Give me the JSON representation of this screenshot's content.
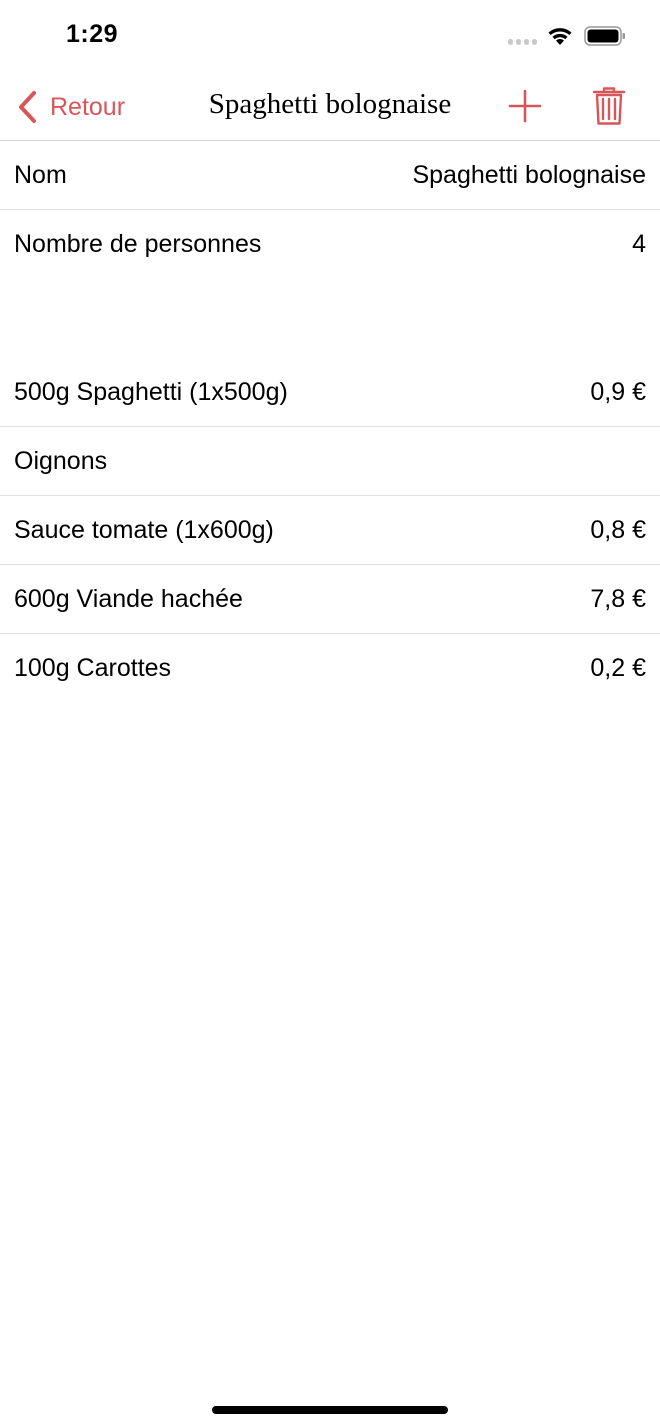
{
  "status_bar": {
    "time": "1:29"
  },
  "nav": {
    "back_label": "Retour",
    "title": "Spaghetti bolognaise"
  },
  "colors": {
    "accent": "#d7565a",
    "separator": "#e0e0e0"
  },
  "icons": {
    "back": "chevron-left-icon",
    "add": "plus-icon",
    "delete": "trash-icon",
    "signal": "cellular-signal-icon",
    "wifi": "wifi-icon",
    "battery": "battery-icon"
  },
  "recipe": {
    "name_label": "Nom",
    "name_value": "Spaghetti bolognaise",
    "people_label": "Nombre de personnes",
    "people_value": "4"
  },
  "ingredients": [
    {
      "label": "500g Spaghetti (1x500g)",
      "price": "0,9 €"
    },
    {
      "label": "Oignons",
      "price": ""
    },
    {
      "label": "Sauce tomate (1x600g)",
      "price": "0,8 €"
    },
    {
      "label": "600g Viande hachée",
      "price": "7,8 €"
    },
    {
      "label": "100g Carottes",
      "price": "0,2 €"
    }
  ]
}
